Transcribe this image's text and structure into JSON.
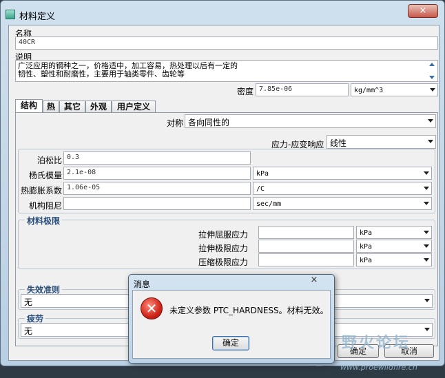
{
  "window": {
    "title": "材料定义",
    "close": "×"
  },
  "name": {
    "label": "名称",
    "value": "40CR"
  },
  "description": {
    "label": "说明",
    "line1": "广泛应用的钢种之一，价格适中，加工容易，热处理以后有一定的",
    "line2": "韧性、塑性和耐磨性，主要用于轴类零件、齿轮等"
  },
  "density": {
    "label": "密度",
    "value": "7.85e-06",
    "unit": "kg/mm^3"
  },
  "tabs": [
    {
      "label": "结构"
    },
    {
      "label": "热"
    },
    {
      "label": "其它"
    },
    {
      "label": "外观"
    },
    {
      "label": "用户定义"
    }
  ],
  "symmetry": {
    "label": "对称",
    "value": "各向同性的"
  },
  "stress_strain": {
    "label": "应力-应变响应",
    "value": "线性"
  },
  "poisson": {
    "label": "泊松比",
    "value": "0.3"
  },
  "young": {
    "label": "杨氏模量",
    "value": "2.1e-08",
    "unit": "kPa"
  },
  "thermal": {
    "label": "热膨胀系数",
    "value": "1.06e-05",
    "unit": "/C"
  },
  "damping": {
    "label": "机构阻尼",
    "value": "",
    "unit": "sec/mm"
  },
  "limits": {
    "title": "材料极限",
    "rows": [
      {
        "label": "拉伸屈服应力",
        "value": "",
        "unit": "kPa"
      },
      {
        "label": "拉伸极限应力",
        "value": "",
        "unit": "kPa"
      },
      {
        "label": "压缩极限应力",
        "value": "",
        "unit": "kPa"
      }
    ]
  },
  "failure": {
    "title": "失效准则",
    "value": "无"
  },
  "fatigue": {
    "title": "疲劳",
    "value": "无"
  },
  "buttons": {
    "ok": "确定",
    "cancel": "取消"
  },
  "dialog": {
    "title": "消息",
    "message": "未定义参数 PTC_HARDNESS。材料无效。",
    "ok": "确定",
    "close": "×"
  },
  "watermark": {
    "text": "野火论坛",
    "url": "www.proewildfire.cn"
  }
}
